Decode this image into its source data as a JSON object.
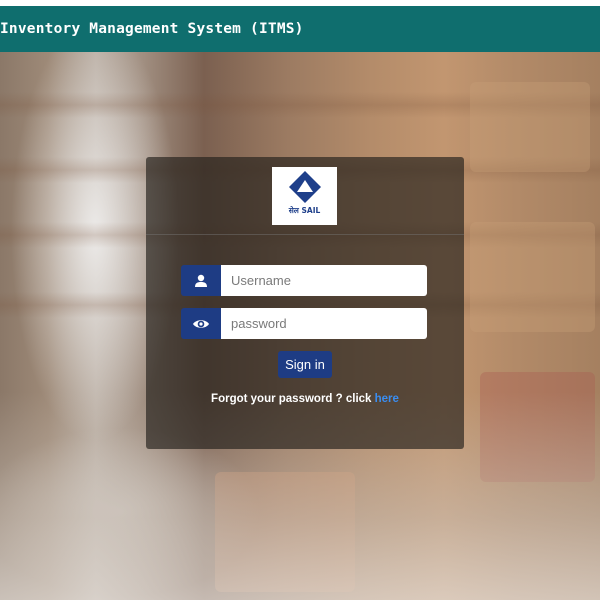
{
  "header": {
    "title": "Inventory Management System (ITMS)",
    "background_color": "#0f6e6e"
  },
  "logo": {
    "text": "सेल SAIL",
    "icon": "sail-logo-icon"
  },
  "login": {
    "username": {
      "icon": "user-icon",
      "placeholder": "Username",
      "value": ""
    },
    "password": {
      "icon": "eye-icon",
      "placeholder": "password",
      "value": ""
    },
    "signin_label": "Sign in",
    "forgot_text": "Forgot your password ? click ",
    "forgot_link": "here"
  },
  "colors": {
    "accent": "#1e3c84",
    "link": "#3a8df0",
    "panel": "rgba(35,32,28,0.66)"
  }
}
